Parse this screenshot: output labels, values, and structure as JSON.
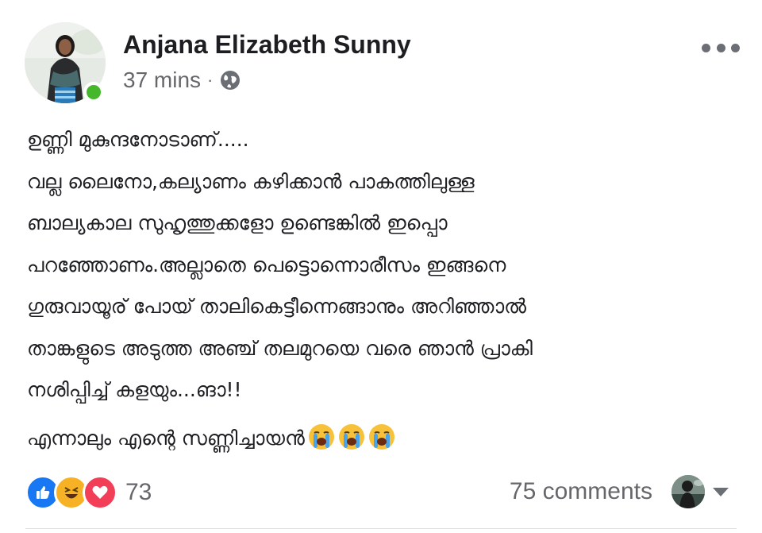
{
  "post": {
    "author": "Anjana Elizabeth Sunny",
    "time": "37 mins",
    "separator": "·",
    "privacy_icon": "globe-icon",
    "status": "online",
    "more_icon": "more-options-icon",
    "lines": [
      "ഉണ്ണി മുകുന്ദനോടാണ്.....",
      "വല്ല ലൈനോ,കല്യാണം കഴിക്കാൻ പാകത്തിലുള്ള",
      "ബാല്യകാല സുഹൃത്തുക്കളോ ഉണ്ടെങ്കിൽ ഇപ്പൊ",
      "പറഞ്ഞോണം.അല്ലാതെ പെട്ടൊന്നൊരീസം ഇങ്ങനെ",
      "ഗുരുവായൂര് പോയ് താലികെട്ടീന്നെങ്ങാനും അറിഞ്ഞാൽ",
      "താങ്കളുടെ അടുത്ത അഞ്ച് തലമുറയെ വരെ ഞാൻ പ്രാകി",
      "നശിപ്പിച്ച് കളയും...ങാ!!"
    ],
    "last_line": "എന്നാലും എന്റെ സണ്ണിച്ചായൻ",
    "last_line_emojis": [
      "loudly-crying-face",
      "loudly-crying-face",
      "loudly-crying-face"
    ]
  },
  "footer": {
    "reactions": [
      "like",
      "haha",
      "love"
    ],
    "reaction_count": "73",
    "comments": "75 comments",
    "colors": {
      "like": "#1877f2",
      "haha": "#f7b125",
      "love": "#f33e58",
      "online": "#44b72b"
    }
  }
}
